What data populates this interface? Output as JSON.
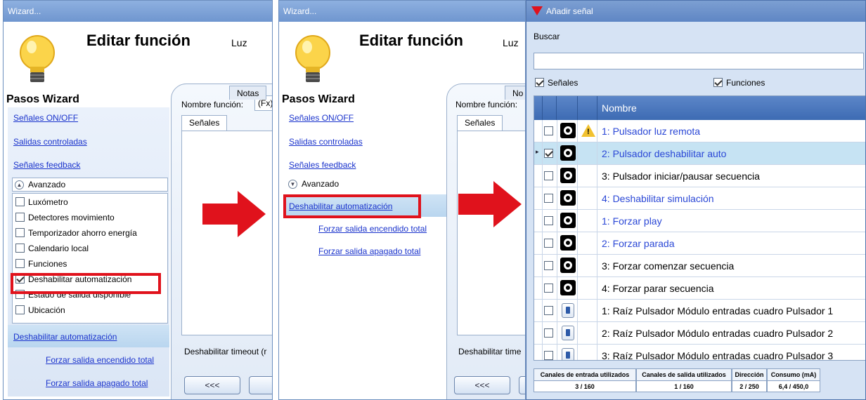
{
  "wizard_left": {
    "title": "Wizard...",
    "edit_title": "Editar función",
    "function_name_short": "Luz",
    "pasos_heading": "Pasos Wizard",
    "steps": {
      "senales": "Señales ON/OFF",
      "salidas": "Salidas controladas",
      "feedback": "Señales feedback"
    },
    "avanzado_label": "Avanzado",
    "advanced_options": [
      {
        "label": "Luxómetro",
        "checked": false
      },
      {
        "label": "Detectores movimiento",
        "checked": false
      },
      {
        "label": "Temporizador ahorro energía",
        "checked": false
      },
      {
        "label": "Calendario local",
        "checked": false
      },
      {
        "label": "Funciones",
        "checked": false
      },
      {
        "label": "Deshabilitar automatización",
        "checked": true
      },
      {
        "label": "Estado de salida disponible",
        "checked": false
      },
      {
        "label": "Ubicación",
        "checked": false
      }
    ],
    "selected_step": "Deshabilitar automatización",
    "sub_steps": [
      "Forzar salida encendido total",
      "Forzar salida apagado total"
    ],
    "nombre_funcion_label": "Nombre función:",
    "fx_value": "(Fx)",
    "tabs": [
      "Señales",
      "Notas"
    ],
    "timeout_label": "Deshabilitar timeout (r",
    "prev_button": "<<<",
    "next_button": ">>"
  },
  "wizard_middle": {
    "title": "Wizard...",
    "edit_title": "Editar función",
    "function_name_short": "Luz",
    "pasos_heading": "Pasos Wizard",
    "steps": {
      "senales": "Señales ON/OFF",
      "salidas": "Salidas controladas",
      "feedback": "Señales feedback"
    },
    "avanzado_label": "Avanzado",
    "selected_step": "Deshabilitar automatización",
    "sub_steps": [
      "Forzar salida encendido total",
      "Forzar salida apagado total"
    ],
    "nombre_funcion_label": "Nombre función:",
    "tabs": [
      "Señales",
      "No"
    ],
    "timeout_label": "Deshabilitar time",
    "prev_button": "<<<"
  },
  "signal_dialog": {
    "title": "Añadir señal",
    "buscar_label": "Buscar",
    "search_value": "",
    "filters": [
      {
        "label": "Señales",
        "checked": true
      },
      {
        "label": "Funciones",
        "checked": true
      }
    ],
    "column_header": "Nombre",
    "rows": [
      {
        "name": "1: Pulsador luz remota",
        "icon": "pushbutton-icon",
        "warning": true,
        "checked": false,
        "blue": true,
        "selected": false
      },
      {
        "name": "2: Pulsador deshabilitar auto",
        "icon": "pushbutton-icon",
        "warning": false,
        "checked": true,
        "blue": true,
        "selected": true
      },
      {
        "name": "3: Pulsador iniciar/pausar secuencia",
        "icon": "pushbutton-icon",
        "warning": false,
        "checked": false,
        "blue": false,
        "selected": false
      },
      {
        "name": "4: Deshabilitar simulación",
        "icon": "pushbutton-icon",
        "warning": false,
        "checked": false,
        "blue": true,
        "selected": false
      },
      {
        "name": "1: Forzar play",
        "icon": "pushbutton-icon",
        "warning": false,
        "checked": false,
        "blue": true,
        "selected": false
      },
      {
        "name": "2: Forzar parada",
        "icon": "pushbutton-icon",
        "warning": false,
        "checked": false,
        "blue": true,
        "selected": false
      },
      {
        "name": "3: Forzar comenzar secuencia",
        "icon": "pushbutton-icon",
        "warning": false,
        "checked": false,
        "blue": false,
        "selected": false
      },
      {
        "name": "4: Forzar parar secuencia",
        "icon": "pushbutton-icon",
        "warning": false,
        "checked": false,
        "blue": false,
        "selected": false
      },
      {
        "name": "1: Raíz Pulsador Módulo entradas cuadro Pulsador 1",
        "icon": "input-module-icon",
        "warning": false,
        "checked": false,
        "blue": false,
        "selected": false
      },
      {
        "name": "2: Raíz Pulsador Módulo entradas cuadro Pulsador 2",
        "icon": "input-module-icon",
        "warning": false,
        "checked": false,
        "blue": false,
        "selected": false
      },
      {
        "name": "3: Raíz Pulsador Módulo entradas cuadro Pulsador 3",
        "icon": "input-module-icon",
        "warning": false,
        "checked": false,
        "blue": false,
        "selected": false
      }
    ],
    "stats": [
      {
        "header": "Canales de entrada utilizados",
        "value": "3 / 160"
      },
      {
        "header": "Canales de salida utilizados",
        "value": "1 / 160"
      },
      {
        "header": "Dirección",
        "value": "2 / 250"
      },
      {
        "header": "Consumo (mA)",
        "value": "6,4 / 450,0"
      }
    ]
  },
  "colors": {
    "highlight_red": "#e0121c",
    "link_blue": "#1a33cc",
    "header_blue": "#3d6bb3"
  }
}
